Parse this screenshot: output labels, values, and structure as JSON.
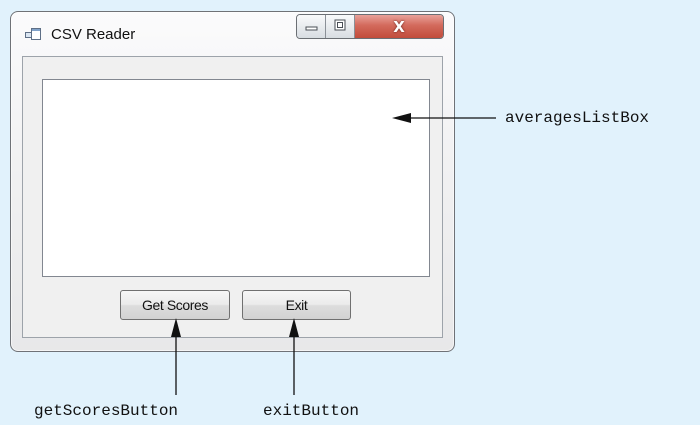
{
  "window": {
    "title": "CSV Reader",
    "app_icon": "window-app-icon",
    "controls": {
      "minimize_icon": "minimize-icon",
      "maximize_icon": "maximize-icon",
      "close_icon": "close-icon",
      "close_glyph": "X"
    }
  },
  "form": {
    "get_scores_label": "Get Scores",
    "exit_label": "Exit"
  },
  "annotations": {
    "averages_listbox": "averagesListBox",
    "get_scores_button": "getScoresButton",
    "exit_button": "exitButton"
  },
  "colors": {
    "background": "#e1f2fc",
    "close_button": "#c24c3b",
    "listbox_background": "#ffffff"
  }
}
